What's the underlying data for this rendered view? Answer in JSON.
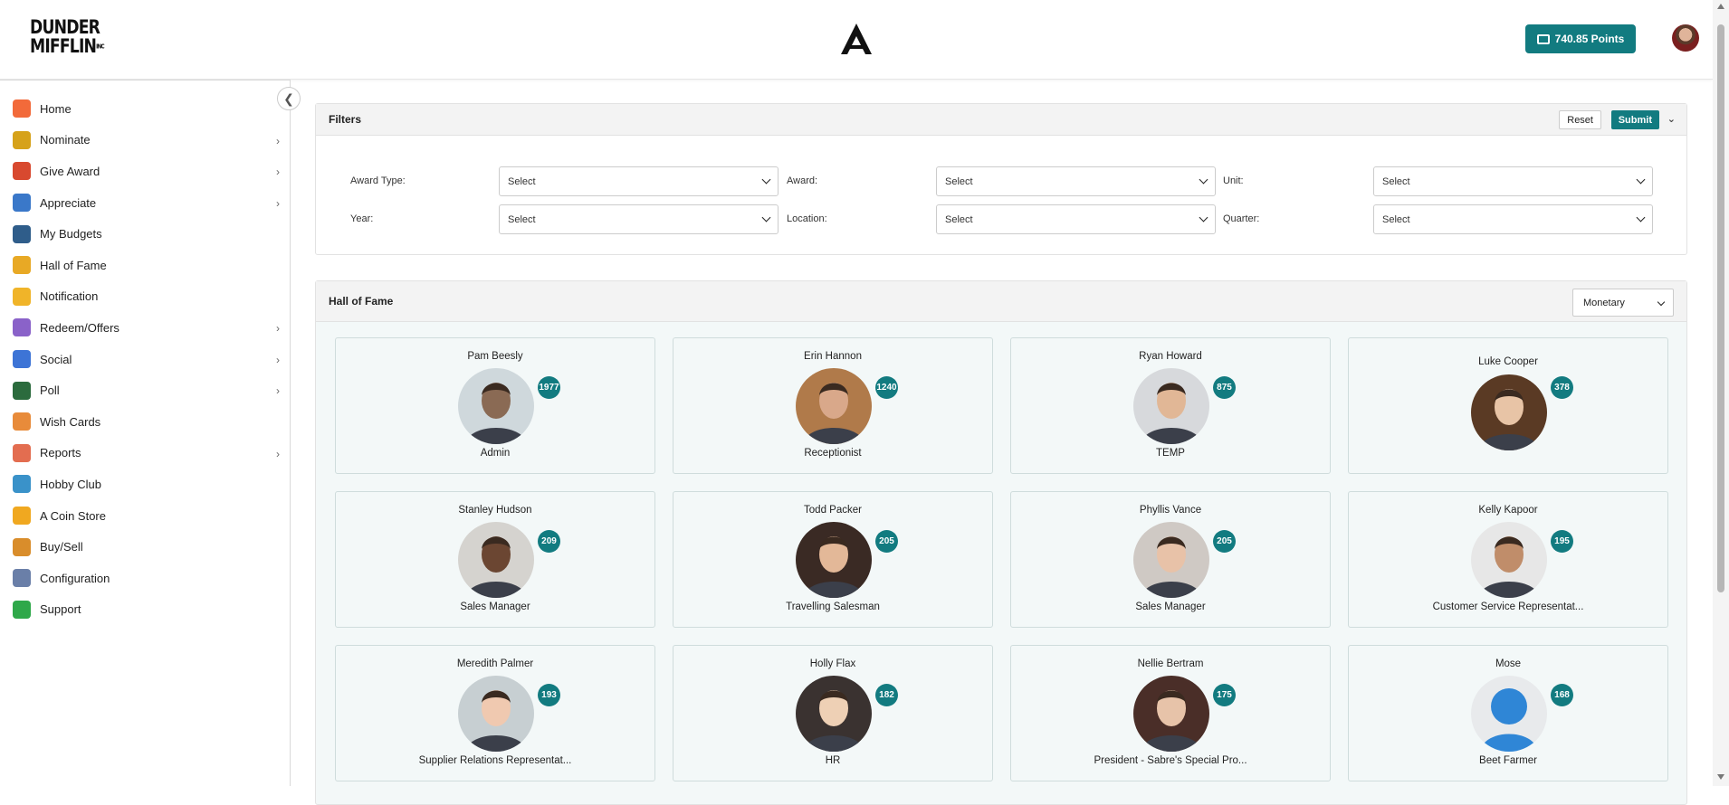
{
  "header": {
    "logo_line1": "DUNDER",
    "logo_line2": "MIFFLIN",
    "logo_suffix": "INC",
    "points_label": "740.85 Points"
  },
  "sidebar": {
    "items": [
      {
        "label": "Home",
        "icon": "home-icon",
        "color": "#f26a3a",
        "arrow": false
      },
      {
        "label": "Nominate",
        "icon": "trophy-icon",
        "color": "#d6a21a",
        "arrow": true
      },
      {
        "label": "Give Award",
        "icon": "gift-icon",
        "color": "#d8492f",
        "arrow": true
      },
      {
        "label": "Appreciate",
        "icon": "ribbon-icon",
        "color": "#3a78c9",
        "arrow": true
      },
      {
        "label": "My Budgets",
        "icon": "wallet-icon",
        "color": "#2f5d8a",
        "arrow": false
      },
      {
        "label": "Hall of Fame",
        "icon": "crown-icon",
        "color": "#e8a925",
        "arrow": false
      },
      {
        "label": "Notification",
        "icon": "bell-icon",
        "color": "#f0b429",
        "arrow": false
      },
      {
        "label": "Redeem/Offers",
        "icon": "redeem-icon",
        "color": "#8a62c9",
        "arrow": true
      },
      {
        "label": "Social",
        "icon": "social-icon",
        "color": "#3d74d6",
        "arrow": true
      },
      {
        "label": "Poll",
        "icon": "poll-icon",
        "color": "#2b6b3d",
        "arrow": true
      },
      {
        "label": "Wish Cards",
        "icon": "party-icon",
        "color": "#e88b3a",
        "arrow": false
      },
      {
        "label": "Reports",
        "icon": "report-icon",
        "color": "#e36d50",
        "arrow": true
      },
      {
        "label": "Hobby Club",
        "icon": "hobby-icon",
        "color": "#3a92c9",
        "arrow": false
      },
      {
        "label": "A Coin Store",
        "icon": "coin-icon",
        "color": "#f0a820",
        "arrow": false
      },
      {
        "label": "Buy/Sell",
        "icon": "bag-icon",
        "color": "#d98d2b",
        "arrow": false
      },
      {
        "label": "Configuration",
        "icon": "config-icon",
        "color": "#6a7fa8",
        "arrow": false
      },
      {
        "label": "Support",
        "icon": "phone-icon",
        "color": "#2fa84a",
        "arrow": false
      }
    ]
  },
  "filters": {
    "title": "Filters",
    "reset_label": "Reset",
    "submit_label": "Submit",
    "fields": [
      {
        "label": "Award Type:",
        "value": "Select"
      },
      {
        "label": "Award:",
        "value": "Select"
      },
      {
        "label": "Unit:",
        "value": "Select"
      },
      {
        "label": "Year:",
        "value": "Select"
      },
      {
        "label": "Location:",
        "value": "Select"
      },
      {
        "label": "Quarter:",
        "value": "Select"
      }
    ]
  },
  "hall_of_fame": {
    "title": "Hall of Fame",
    "type_value": "Monetary",
    "people": [
      {
        "name": "Pam Beesly",
        "score": "1977",
        "role": "Admin",
        "tone": "#8a6a54",
        "bg": "#cfd8dc"
      },
      {
        "name": "Erin Hannon",
        "score": "1240",
        "role": "Receptionist",
        "tone": "#d9a88a",
        "bg": "#b07a4a"
      },
      {
        "name": "Ryan Howard",
        "score": "875",
        "role": "TEMP",
        "tone": "#e1b796",
        "bg": "#d7d9dc"
      },
      {
        "name": "Luke Cooper",
        "score": "378",
        "role": "",
        "tone": "#e8c4a6",
        "bg": "#5a3a24"
      },
      {
        "name": "Stanley Hudson",
        "score": "209",
        "role": "Sales Manager",
        "tone": "#6b4632",
        "bg": "#d5d3cf"
      },
      {
        "name": "Todd Packer",
        "score": "205",
        "role": "Travelling Salesman",
        "tone": "#e3b898",
        "bg": "#3a2a24"
      },
      {
        "name": "Phyllis Vance",
        "score": "205",
        "role": "Sales Manager",
        "tone": "#e8c2a8",
        "bg": "#cfc9c4"
      },
      {
        "name": "Kelly Kapoor",
        "score": "195",
        "role": "Customer Service Representat...",
        "tone": "#c08d6a",
        "bg": "#e7e7e7"
      },
      {
        "name": "Meredith Palmer",
        "score": "193",
        "role": "Supplier Relations Representat...",
        "tone": "#f0c9b0",
        "bg": "#c7cfd2"
      },
      {
        "name": "Holly Flax",
        "score": "182",
        "role": "HR",
        "tone": "#eed0b5",
        "bg": "#3a3230"
      },
      {
        "name": "Nellie Bertram",
        "score": "175",
        "role": "President - Sabre's Special Pro...",
        "tone": "#e7c3a9",
        "bg": "#4a2e28"
      },
      {
        "name": "Mose",
        "score": "168",
        "role": "Beet Farmer",
        "tone": "default",
        "bg": "#e8eaec"
      }
    ]
  }
}
